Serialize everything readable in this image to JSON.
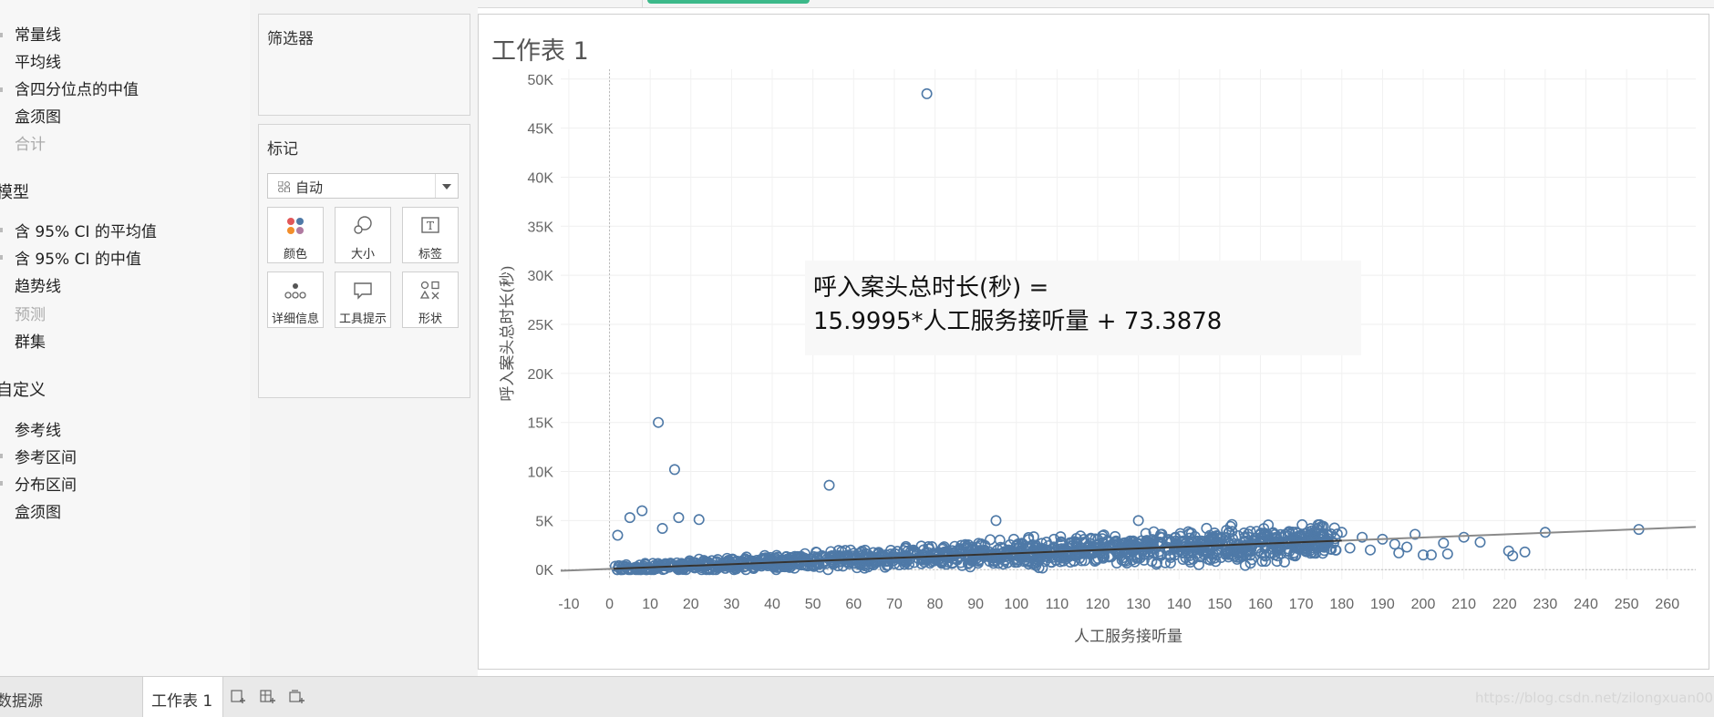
{
  "analytics": {
    "group1": [
      "常量线",
      "平均线",
      "含四分位点的中值",
      "盒须图",
      "合计"
    ],
    "section_model": "模型",
    "group2": [
      "含 95% CI 的平均值",
      "含 95% CI 的中值",
      "趋势线",
      "预测",
      "群集"
    ],
    "section_custom": "自定义",
    "group3": [
      "参考线",
      "参考区间",
      "分布区间",
      "盒须图"
    ]
  },
  "filters": {
    "title": "筛选器"
  },
  "marks": {
    "title": "标记",
    "type": "自动",
    "buttons": [
      "颜色",
      "大小",
      "标签",
      "详细信息",
      "工具提示",
      "形状"
    ]
  },
  "sheet": {
    "title": "工作表 1",
    "annotation_line1": "呼入案头总时长(秒) =",
    "annotation_line2": "15.9995*人工服务接听量 + 73.3878"
  },
  "chart_data": {
    "type": "scatter",
    "xlabel": "人工服务接听量",
    "ylabel": "呼入案头总时长(秒)",
    "xlim": [
      -12,
      267
    ],
    "ylim": [
      -1000,
      51000
    ],
    "x_ticks": [
      "-10",
      "0",
      "10",
      "20",
      "30",
      "40",
      "50",
      "60",
      "70",
      "80",
      "90",
      "100",
      "110",
      "120",
      "130",
      "140",
      "150",
      "160",
      "170",
      "180",
      "190",
      "200",
      "210",
      "220",
      "230",
      "240",
      "250",
      "260"
    ],
    "y_ticks": [
      "0K",
      "5K",
      "10K",
      "15K",
      "20K",
      "25K",
      "30K",
      "35K",
      "40K",
      "45K",
      "50K"
    ],
    "trend": {
      "slope": 15.9995,
      "intercept": 73.3878
    },
    "mark_color": "#4e79a7",
    "outliers": [
      [
        78,
        48500
      ],
      [
        12,
        15000
      ],
      [
        16,
        10200
      ],
      [
        54,
        8600
      ],
      [
        8,
        6000
      ],
      [
        5,
        5300
      ],
      [
        17,
        5300
      ],
      [
        22,
        5100
      ],
      [
        2,
        3500
      ],
      [
        13,
        4200
      ],
      [
        95,
        5000
      ],
      [
        130,
        5000
      ],
      [
        153,
        4600
      ],
      [
        198,
        3600
      ],
      [
        230,
        3800
      ],
      [
        253,
        4100
      ],
      [
        210,
        3300
      ],
      [
        222,
        1400
      ],
      [
        225,
        1800
      ],
      [
        221,
        1900
      ],
      [
        205,
        2700
      ],
      [
        202,
        1500
      ],
      [
        206,
        1600
      ],
      [
        185,
        3300
      ],
      [
        190,
        3100
      ],
      [
        193,
        2600
      ],
      [
        180,
        3800
      ],
      [
        178,
        2700
      ],
      [
        182,
        2200
      ],
      [
        187,
        2000
      ],
      [
        194,
        1700
      ],
      [
        214,
        2800
      ],
      [
        200,
        1500
      ],
      [
        196,
        2300
      ]
    ]
  },
  "statusbar": {
    "datasource": "数据源",
    "active_tab": "工作表 1"
  },
  "watermark": "https://blog.csdn.net/zilongxuan008"
}
